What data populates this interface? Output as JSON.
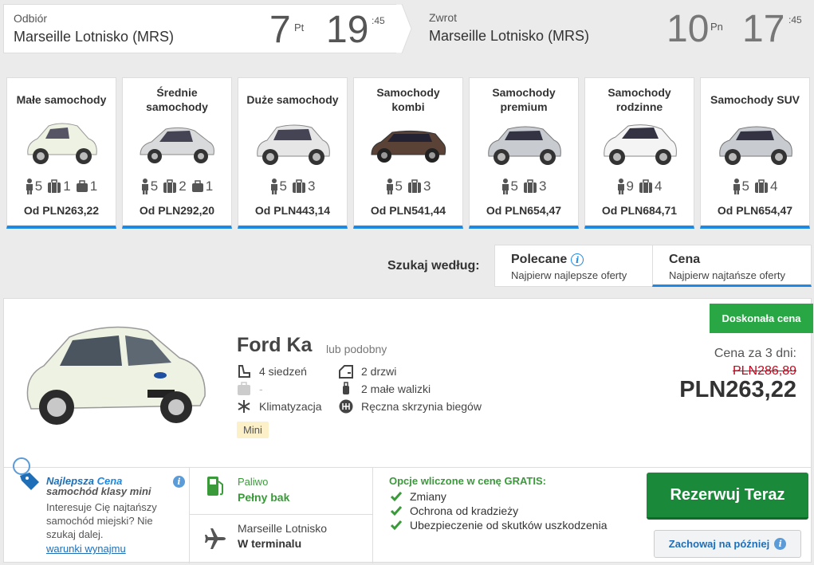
{
  "pickup": {
    "label": "Odbiór",
    "location": "Marseille Lotnisko (MRS)",
    "day": "7",
    "weekday": "Pt",
    "hour": "19",
    "minute": ":45"
  },
  "return": {
    "label": "Zwrot",
    "location": "Marseille Lotnisko (MRS)",
    "day": "10",
    "weekday": "Pn",
    "hour": "17",
    "minute": ":45"
  },
  "categories": [
    {
      "name": "Małe samochody",
      "passengers": "5",
      "bags_large": "1",
      "bags_small": "1",
      "price": "Od PLN263,22",
      "color": "#eef2e2"
    },
    {
      "name": "Średnie samochody",
      "passengers": "5",
      "bags_large": "2",
      "bags_small": "1",
      "price": "Od PLN292,20",
      "color": "#d9dadb"
    },
    {
      "name": "Duże samochody",
      "passengers": "5",
      "bags_large": "3",
      "bags_small": "",
      "price": "Od PLN443,14",
      "color": "#e6e6e6"
    },
    {
      "name": "Samochody kombi",
      "passengers": "5",
      "bags_large": "3",
      "bags_small": "",
      "price": "Od PLN541,44",
      "color": "#5a4236"
    },
    {
      "name": "Samochody premium",
      "passengers": "5",
      "bags_large": "3",
      "bags_small": "",
      "price": "Od PLN654,47",
      "color": "#c8cbcf"
    },
    {
      "name": "Samochody rodzinne",
      "passengers": "9",
      "bags_large": "4",
      "bags_small": "",
      "price": "Od PLN684,71",
      "color": "#f4f4f4"
    },
    {
      "name": "Samochody SUV",
      "passengers": "5",
      "bags_large": "4",
      "bags_small": "",
      "price": "Od PLN654,47",
      "color": "#c8cbcf"
    }
  ],
  "sort": {
    "label": "Szukaj według:",
    "options": [
      {
        "title": "Polecane",
        "subtitle": "Najpierw najlepsze oferty"
      },
      {
        "title": "Cena",
        "subtitle": "Najpierw najtańsze oferty"
      }
    ]
  },
  "offer": {
    "badge": "Doskonała cena",
    "model": "Ford Ka",
    "similar": "lub podobny",
    "features": {
      "seats": "4 siedzeń",
      "doors": "2 drzwi",
      "large_bags": "-",
      "small_bags": "2 małe walizki",
      "ac": "Klimatyzacja",
      "gearbox": "Ręczna skrzynia biegów"
    },
    "class_tag": "Mini",
    "price_label": "Cena za 3 dni:",
    "old_price": "PLN286,89",
    "price": "PLN263,22",
    "deal_title_a": "Najlepsza",
    "deal_title_b": "Cena",
    "deal_subtitle": "samochód klasy mini",
    "deal_text": "Interesuje Cię najtańszy samochód miejski? Nie szukaj dalej.",
    "terms_link": "warunki wynajmu",
    "fuel_label": "Paliwo",
    "fuel_value": "Pełny bak",
    "location_name": "Marseille Lotnisko",
    "location_type": "W terminalu",
    "free_header": "Opcje wliczone w cenę GRATIS:",
    "free_items": [
      "Zmiany",
      "Ochrona od kradzieży",
      "Ubezpieczenie od skutków uszkodzenia"
    ],
    "book_button": "Rezerwuj Teraz",
    "save_button": "Zachowaj na później",
    "info_glyph": "i"
  },
  "colors": {
    "accent_blue": "#1e88e5",
    "green": "#29a745",
    "book_green": "#1a8a3a",
    "red": "#d0021b"
  }
}
